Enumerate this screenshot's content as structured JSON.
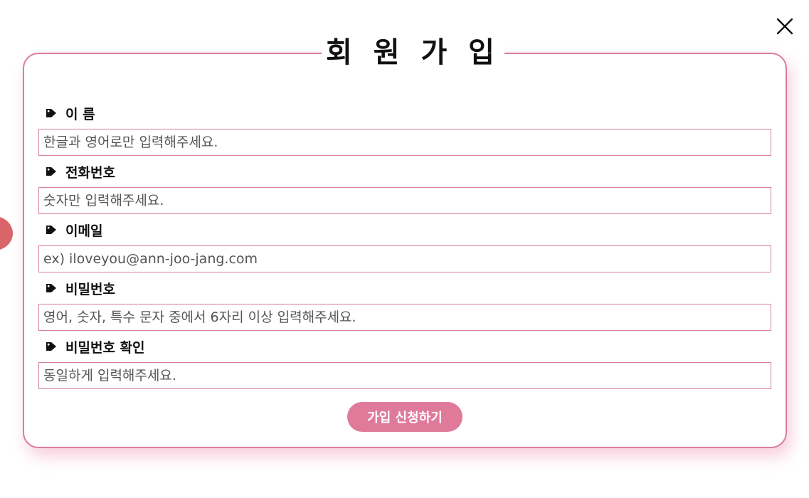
{
  "dialog": {
    "title": "회 원 가 입",
    "close_icon": "close-icon",
    "accent_color": "#dd7aa0",
    "button_color": "#e07a9b"
  },
  "fields": [
    {
      "label": "이 름",
      "placeholder": "한글과 영어로만 입력해주세요.",
      "value": ""
    },
    {
      "label": "전화번호",
      "placeholder": "숫자만 입력해주세요.",
      "value": ""
    },
    {
      "label": "이메일",
      "placeholder": "ex) iloveyou@ann-joo-jang.com",
      "value": ""
    },
    {
      "label": "비밀번호",
      "placeholder": "영어, 숫자, 특수 문자 중에서 6자리 이상 입력해주세요.",
      "value": ""
    },
    {
      "label": "비밀번호 확인",
      "placeholder": "동일하게 입력해주세요.",
      "value": ""
    }
  ],
  "submit": {
    "label": "가입 신청하기"
  },
  "icons": {
    "label_icon": "tag-icon"
  }
}
